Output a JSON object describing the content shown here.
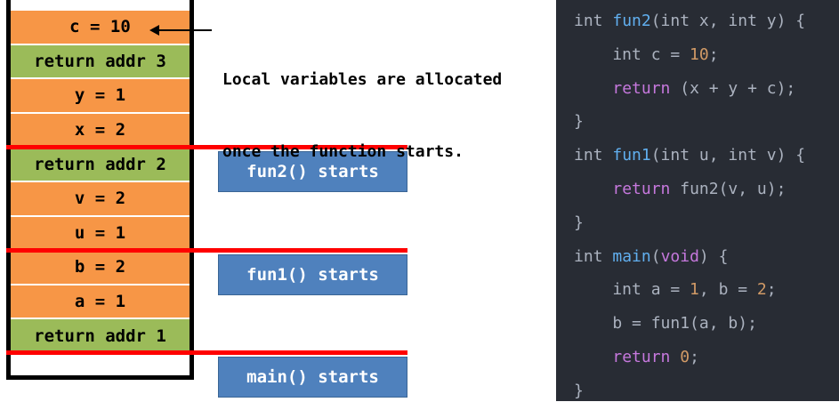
{
  "stack": {
    "cells": [
      {
        "label": "c = 10",
        "kind": "local"
      },
      {
        "label": "return addr 3",
        "kind": "return"
      },
      {
        "label": "y = 1",
        "kind": "local"
      },
      {
        "label": "x = 2",
        "kind": "local"
      },
      {
        "label": "return addr 2",
        "kind": "return"
      },
      {
        "label": "v = 2",
        "kind": "local"
      },
      {
        "label": "u = 1",
        "kind": "local"
      },
      {
        "label": "b = 2",
        "kind": "local"
      },
      {
        "label": "a = 1",
        "kind": "local"
      },
      {
        "label": "return addr 1",
        "kind": "return"
      }
    ],
    "frame_starts": [
      "fun2() starts",
      "fun1() starts",
      "main() starts"
    ]
  },
  "annotation": {
    "line1": "Local variables are allocated",
    "line2": "once the function starts."
  },
  "code": {
    "lines": [
      [
        {
          "t": "int",
          "c": "pl"
        },
        {
          "t": " ",
          "c": "pl"
        },
        {
          "t": "fun2",
          "c": "fn"
        },
        {
          "t": "(int x, int y) {",
          "c": "pl"
        }
      ],
      [
        {
          "t": "    int c = ",
          "c": "pl"
        },
        {
          "t": "10",
          "c": "num"
        },
        {
          "t": ";",
          "c": "pl"
        }
      ],
      [
        {
          "t": "    ",
          "c": "pl"
        },
        {
          "t": "return",
          "c": "kw"
        },
        {
          "t": " (x + y + c);",
          "c": "pl"
        }
      ],
      [
        {
          "t": "}",
          "c": "pl"
        }
      ],
      [
        {
          "t": "int",
          "c": "pl"
        },
        {
          "t": " ",
          "c": "pl"
        },
        {
          "t": "fun1",
          "c": "fn"
        },
        {
          "t": "(int u, int v) {",
          "c": "pl"
        }
      ],
      [
        {
          "t": "    ",
          "c": "pl"
        },
        {
          "t": "return",
          "c": "kw"
        },
        {
          "t": " fun2(v, u);",
          "c": "pl"
        }
      ],
      [
        {
          "t": "}",
          "c": "pl"
        }
      ],
      [
        {
          "t": "int",
          "c": "pl"
        },
        {
          "t": " ",
          "c": "pl"
        },
        {
          "t": "main",
          "c": "fn"
        },
        {
          "t": "(",
          "c": "pl"
        },
        {
          "t": "void",
          "c": "kw"
        },
        {
          "t": ") {",
          "c": "pl"
        }
      ],
      [
        {
          "t": "    int a = ",
          "c": "pl"
        },
        {
          "t": "1",
          "c": "num"
        },
        {
          "t": ", b = ",
          "c": "pl"
        },
        {
          "t": "2",
          "c": "num"
        },
        {
          "t": ";",
          "c": "pl"
        }
      ],
      [
        {
          "t": "    b = fun1(a, b);",
          "c": "pl"
        }
      ],
      [
        {
          "t": "    ",
          "c": "pl"
        },
        {
          "t": "return",
          "c": "kw"
        },
        {
          "t": " ",
          "c": "pl"
        },
        {
          "t": "0",
          "c": "num"
        },
        {
          "t": ";",
          "c": "pl"
        }
      ],
      [
        {
          "t": "}",
          "c": "pl"
        }
      ]
    ]
  },
  "colors": {
    "local_cell": "#f79646",
    "return_cell": "#9bbb59",
    "frame_boundary": "#ff0000",
    "start_box": "#4f81bd",
    "code_background": "#282c34"
  }
}
